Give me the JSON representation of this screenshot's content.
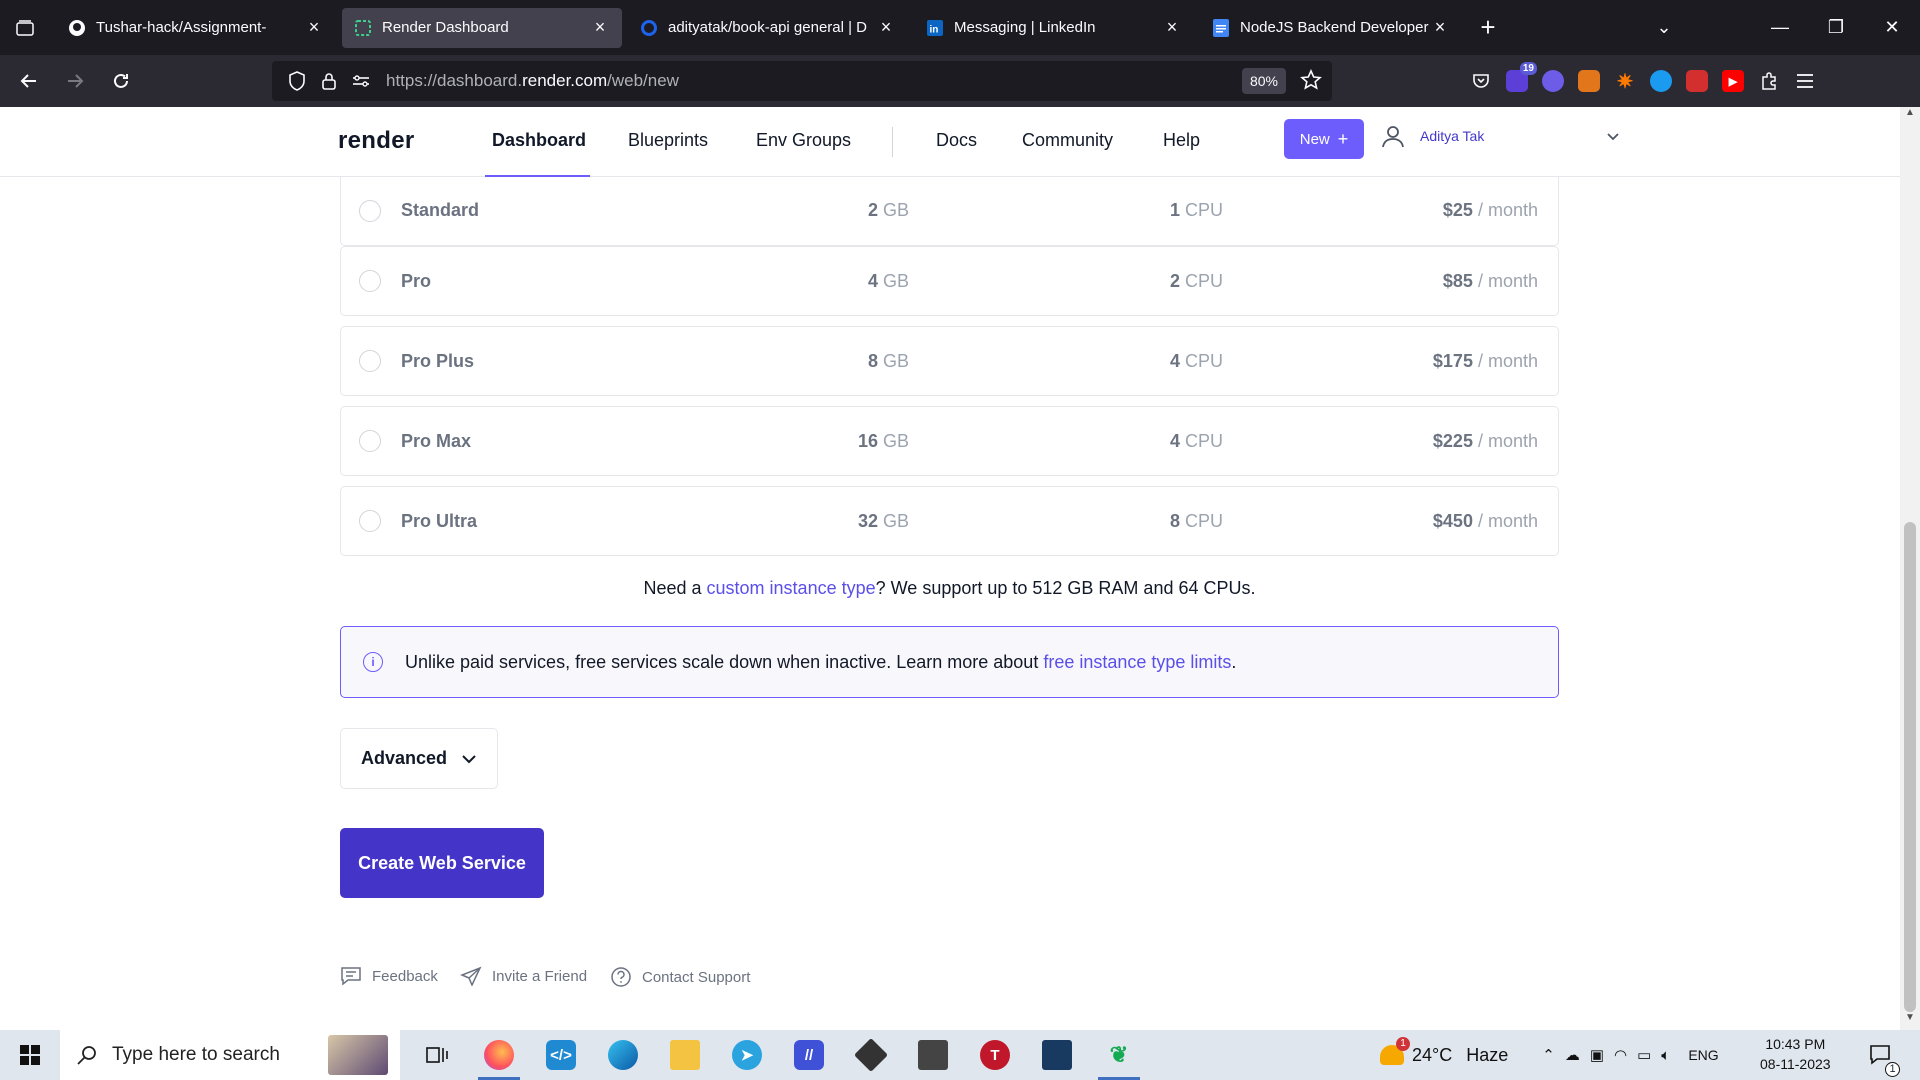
{
  "browser": {
    "tabs": [
      {
        "title": "Tushar-hack/Assignment-",
        "icon": "github-icon",
        "active": false
      },
      {
        "title": "Render Dashboard",
        "icon": "render-icon",
        "active": true
      },
      {
        "title": "adityatak/book-api general | D",
        "icon": "docker-icon",
        "active": false
      },
      {
        "title": "Messaging | LinkedIn",
        "icon": "linkedin-icon",
        "active": false
      },
      {
        "title": "NodeJS Backend Developer Ch",
        "icon": "google-docs-icon",
        "active": false
      }
    ],
    "url_host_prefix": "https://dashboard.",
    "url_host_main": "render.com",
    "url_path": "/web/new",
    "zoom": "80%",
    "extension_badge": "19"
  },
  "header": {
    "logo": "render",
    "nav": {
      "dashboard": "Dashboard",
      "blueprints": "Blueprints",
      "env_groups": "Env Groups",
      "docs": "Docs",
      "community": "Community",
      "help": "Help"
    },
    "new_button": "New",
    "new_button_icon": "+",
    "user_name": "Aditya Tak"
  },
  "plans": [
    {
      "name": "Standard",
      "ram": "2",
      "ram_unit": "GB",
      "cpu": "1",
      "cpu_unit": "CPU",
      "price": "$25",
      "period": "/ month"
    },
    {
      "name": "Pro",
      "ram": "4",
      "ram_unit": "GB",
      "cpu": "2",
      "cpu_unit": "CPU",
      "price": "$85",
      "period": "/ month"
    },
    {
      "name": "Pro Plus",
      "ram": "8",
      "ram_unit": "GB",
      "cpu": "4",
      "cpu_unit": "CPU",
      "price": "$175",
      "period": "/ month"
    },
    {
      "name": "Pro Max",
      "ram": "16",
      "ram_unit": "GB",
      "cpu": "4",
      "cpu_unit": "CPU",
      "price": "$225",
      "period": "/ month"
    },
    {
      "name": "Pro Ultra",
      "ram": "32",
      "ram_unit": "GB",
      "cpu": "8",
      "cpu_unit": "CPU",
      "price": "$450",
      "period": "/ month"
    }
  ],
  "custom_note": {
    "before": "Need a ",
    "link": "custom instance type",
    "after": "? We support up to 512 GB RAM and 64 CPUs."
  },
  "info": {
    "text": "Unlike paid services, free services scale down when inactive. Learn more about ",
    "link": "free instance type limits",
    "end": "."
  },
  "advanced_label": "Advanced",
  "create_button": "Create Web Service",
  "footer": {
    "feedback": "Feedback",
    "invite": "Invite a Friend",
    "support": "Contact Support"
  },
  "taskbar": {
    "search_placeholder": "Type here to search",
    "weather_temp": "24°C",
    "weather_desc": "Haze",
    "weather_badge": "1",
    "language": "ENG",
    "time": "10:43 PM",
    "date": "08-11-2023",
    "notification_count": "1"
  },
  "colors": {
    "accent": "#6d5dfc",
    "create_button": "#4434c8",
    "link": "#5b4fe9"
  }
}
